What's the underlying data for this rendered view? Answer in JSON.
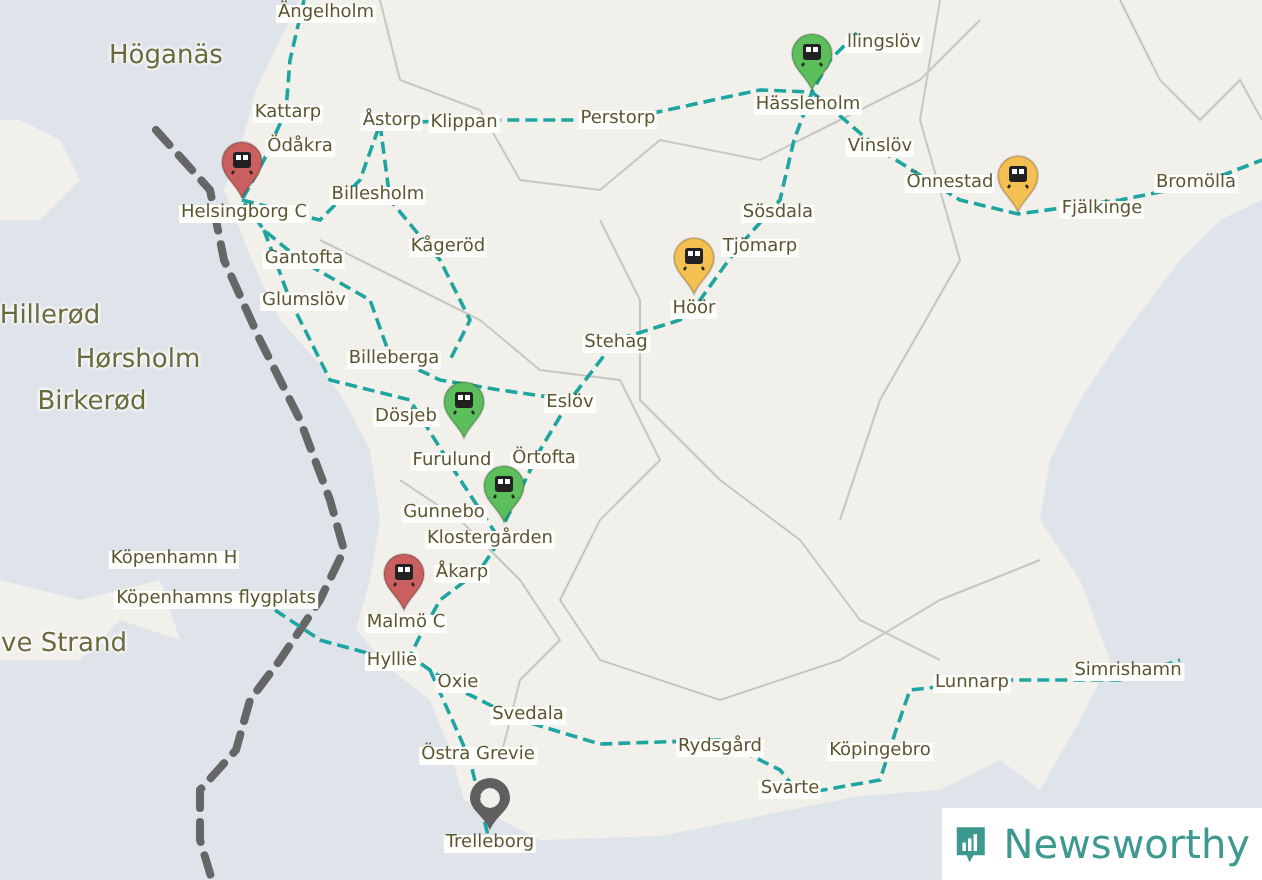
{
  "map": {
    "place_labels": [
      {
        "text": "Höganäs",
        "kind": "town"
      },
      {
        "text": "Hillerød",
        "kind": "town"
      },
      {
        "text": "Hørsholm",
        "kind": "town"
      },
      {
        "text": "Birkerød",
        "kind": "town"
      },
      {
        "text": "ve Strand",
        "kind": "town"
      }
    ],
    "station_labels": [
      "Ängelholm",
      "Kattarp",
      "Ödåkra",
      "Åstorp",
      "Klippan",
      "Perstorp",
      "Helsingborg C",
      "Billesholm",
      "Gantofta",
      "Kågeröd",
      "Glumslöv",
      "Billeberga",
      "Stehag",
      "Eslöv",
      "Dösjeb",
      "Furulund",
      "Örtofta",
      "Gunnebo",
      "Klostergården",
      "Åkarp",
      "Köpenhamn H",
      "Köpenhamns flygplats",
      "Malmö C",
      "Hyllie",
      "Oxie",
      "Svedala",
      "Östra Grevie",
      "Trelleborg",
      "Rydsgård",
      "Köpingebro",
      "Svarte",
      "Lunnarp",
      "Simrishamn",
      "llingslöv",
      "Hässleholm",
      "Vinslöv",
      "Önnestad",
      "Fjälkinge",
      "Bromölla",
      "Sösdala",
      "Tjömarp",
      "Höör"
    ],
    "station_pins": [
      {
        "color": "#c9605f"
      },
      {
        "color": "#5cbf5c"
      },
      {
        "color": "#f5c052"
      },
      {
        "color": "#f5c052"
      },
      {
        "color": "#5cbf5c"
      },
      {
        "color": "#5cbf5c"
      },
      {
        "color": "#c9605f"
      }
    ]
  },
  "logo": {
    "text": "Newsworthy"
  }
}
